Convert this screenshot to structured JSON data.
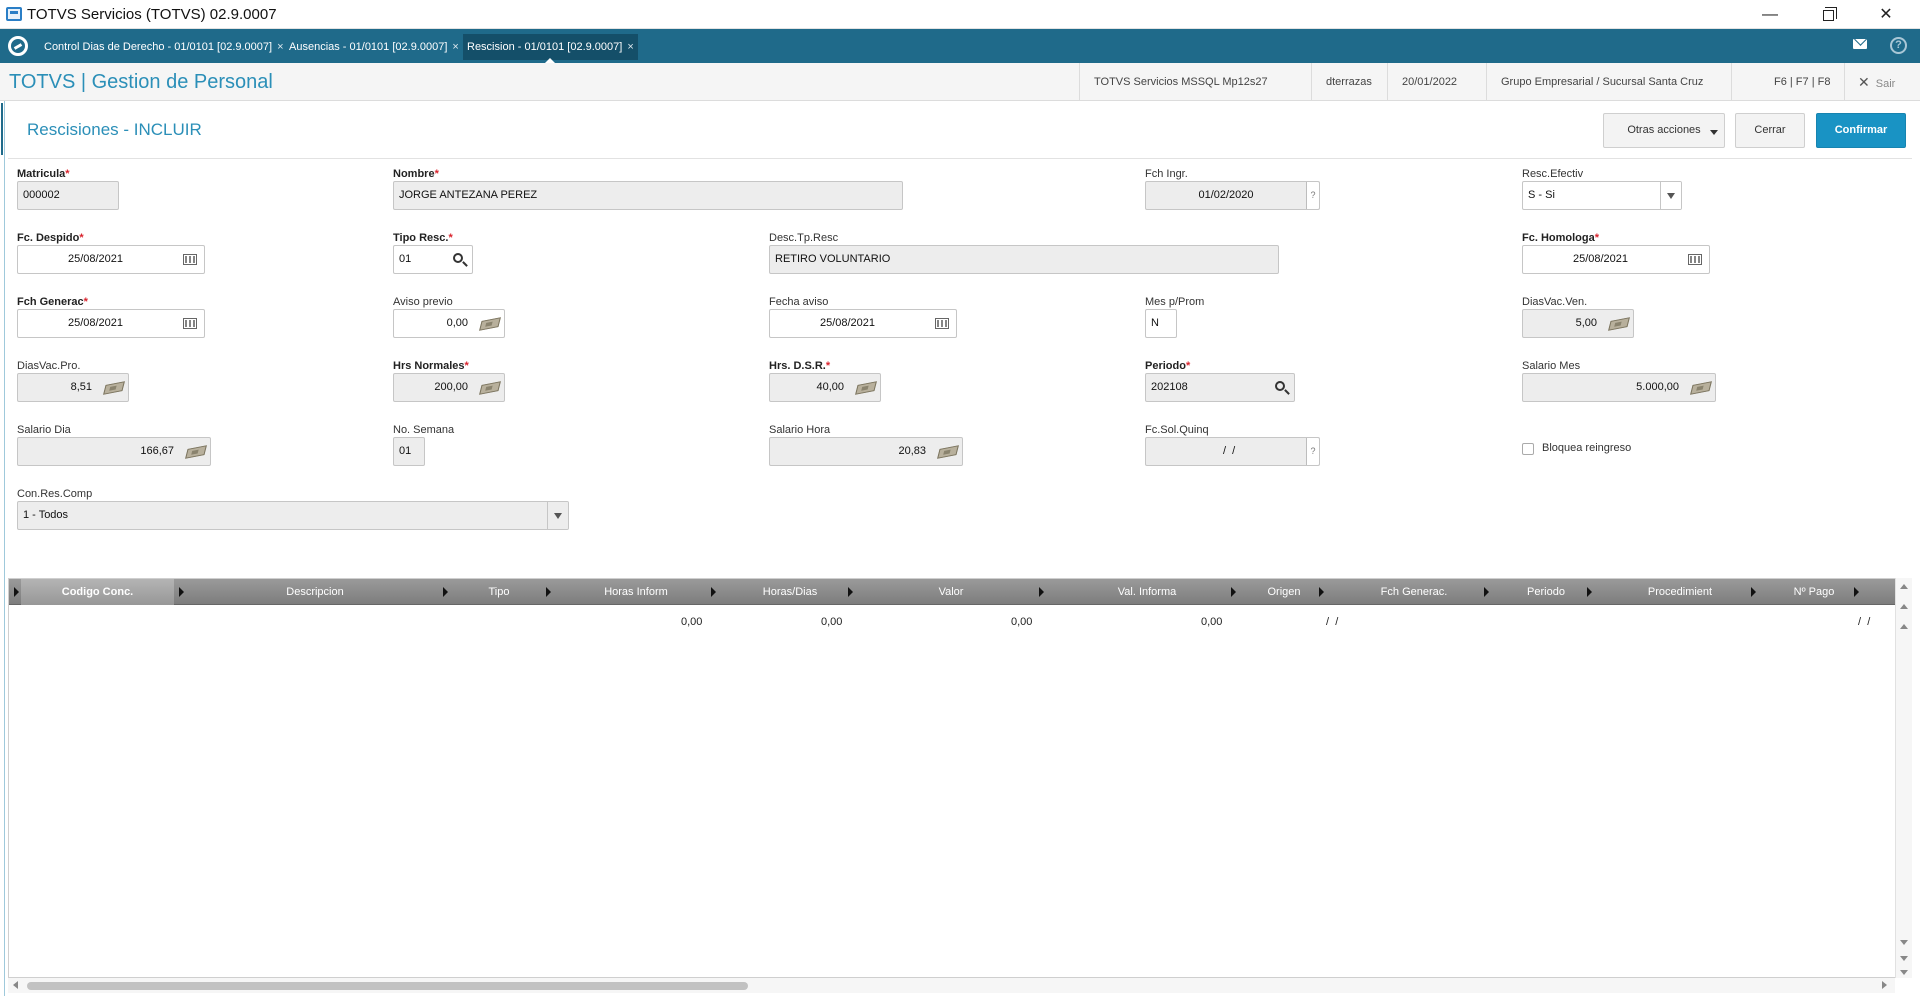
{
  "window": {
    "title": "TOTVS Servicios (TOTVS) 02.9.0007",
    "minimize_glyph": "—",
    "close_glyph": "✕"
  },
  "tabs": [
    {
      "label": "Control Dias de Derecho - 01/0101 [02.9.0007]",
      "close": "×"
    },
    {
      "label": "Ausencias - 01/0101 [02.9.0007]",
      "close": "×"
    },
    {
      "label": "Rescision - 01/0101 [02.9.0007]",
      "close": "×"
    }
  ],
  "tabbar_help": "?",
  "header": {
    "brand": "TOTVS | Gestion de Personal",
    "environment": "TOTVS Servicios MSSQL Mp12s27",
    "user": "dterrazas",
    "date": "20/01/2022",
    "company": "Grupo Empresarial / Sucursal Santa Cruz",
    "shortcuts": "F6 | F7 | F8",
    "exit": "Sair",
    "exit_glyph": "✕"
  },
  "form": {
    "title": "Rescisiones - INCLUIR",
    "actions": {
      "other": "Otras acciones",
      "close": "Cerrar",
      "confirm": "Confirmar"
    }
  },
  "required_mark": "*",
  "fields": {
    "matricula": {
      "label": "Matricula",
      "value": "000002"
    },
    "nombre": {
      "label": "Nombre",
      "value": "JORGE  ANTEZANA PEREZ"
    },
    "fch_ingr": {
      "label": "Fch Ingr.",
      "value": "01/02/2020",
      "help": "?"
    },
    "resc_efectiv": {
      "label": "Resc.Efectiv",
      "value": "S - Si"
    },
    "fc_despido": {
      "label": "Fc. Despido",
      "value": "25/08/2021"
    },
    "tipo_resc": {
      "label": "Tipo Resc.",
      "value": "01"
    },
    "desc_tp_resc": {
      "label": "Desc.Tp.Resc",
      "value": "RETIRO VOLUNTARIO"
    },
    "fc_homologa": {
      "label": "Fc. Homologa",
      "value": "25/08/2021"
    },
    "fch_generac": {
      "label": "Fch Generac",
      "value": "25/08/2021"
    },
    "aviso_previo": {
      "label": "Aviso previo",
      "value": "0,00"
    },
    "fecha_aviso": {
      "label": "Fecha aviso",
      "value": "25/08/2021"
    },
    "mes_p_prom": {
      "label": "Mes p/Prom",
      "value": "N"
    },
    "dias_vac_ven": {
      "label": "DiasVac.Ven.",
      "value": "5,00"
    },
    "dias_vac_pro": {
      "label": "DiasVac.Pro.",
      "value": "8,51"
    },
    "hrs_normales": {
      "label": "Hrs Normales",
      "value": "200,00"
    },
    "hrs_dsr": {
      "label": "Hrs. D.S.R.",
      "value": "40,00"
    },
    "periodo": {
      "label": "Periodo",
      "value": "202108"
    },
    "salario_mes": {
      "label": "Salario Mes",
      "value": "5.000,00"
    },
    "salario_dia": {
      "label": "Salario Dia",
      "value": "166,67"
    },
    "no_semana": {
      "label": "No. Semana",
      "value": "01"
    },
    "salario_hora": {
      "label": "Salario Hora",
      "value": "20,83"
    },
    "fc_sol_quinq": {
      "label": "Fc.Sol.Quinq",
      "value": "  /  /",
      "help": "?"
    },
    "bloquea_reingreso": {
      "label": "Bloquea reingreso",
      "checked": false
    },
    "con_res_comp": {
      "label": "Con.Res.Comp",
      "value": "1 - Todos"
    }
  },
  "grid": {
    "columns": [
      "Codigo Conc.",
      "Descripcion",
      "Tipo",
      "Horas Inform",
      "Horas/Dias",
      "Valor",
      "Val. Informa",
      "Origen",
      "Fch Generac.",
      "Periodo",
      "Procedimient",
      "Nº Pago"
    ],
    "row": {
      "horas_inform": "0,00",
      "horas_dias": "0,00",
      "valor": "0,00",
      "val_informa": "0,00",
      "fch_generac": " /  /",
      "n_pago": " /  /"
    }
  },
  "icons": {
    "app": "app-window-icon",
    "tabbar_logo": "totvs-logo-icon",
    "mail": "mail-icon",
    "help": "help-icon",
    "calendar": "calendar-icon",
    "calculator": "calculator-icon",
    "search": "search-icon"
  },
  "colors": {
    "tabbar": "#1f6a8a",
    "brand": "#2b8fb8",
    "confirm": "#1993c4",
    "required": "#d9232d",
    "grid_header": "#8a8a8a"
  }
}
